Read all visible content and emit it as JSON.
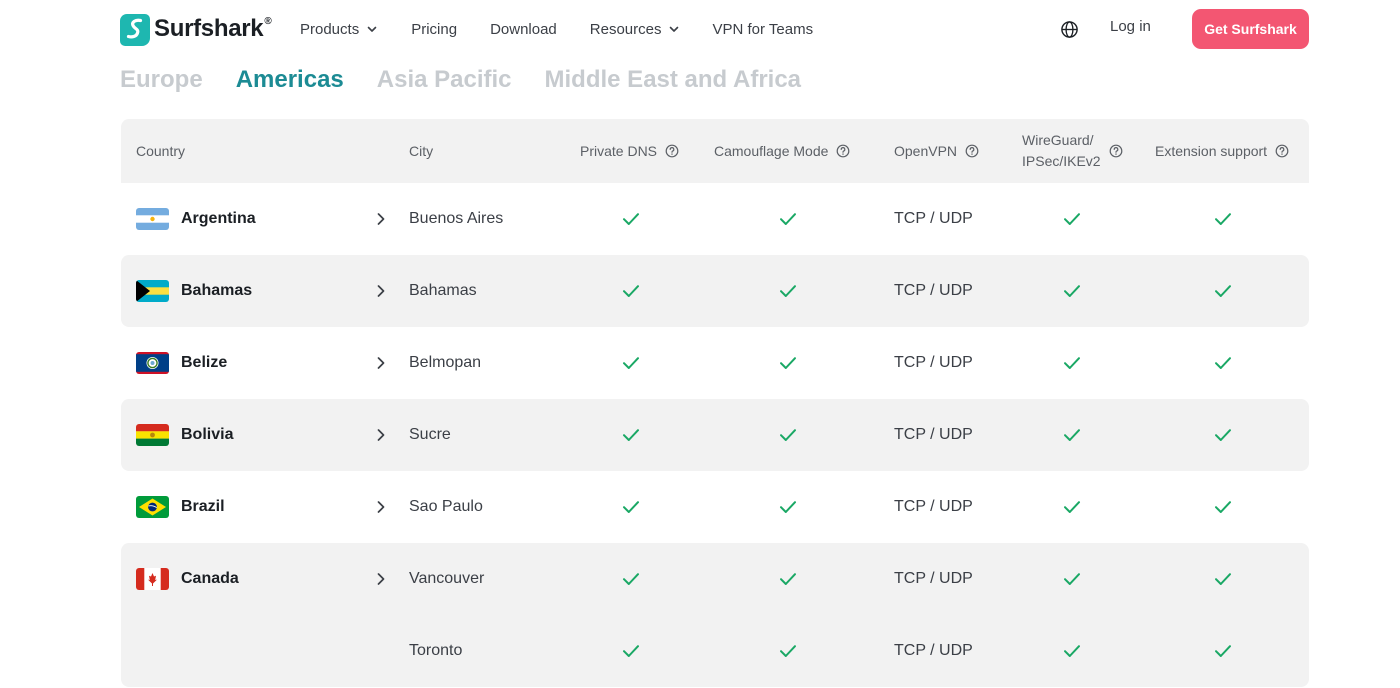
{
  "brand": {
    "name": "Surfshark",
    "reg_mark": "®",
    "accent_color": "#1c8b94",
    "logo_color": "#1eb7b0",
    "cta_color": "#f35672",
    "check_color": "#1aa865"
  },
  "nav": {
    "products": "Products",
    "pricing": "Pricing",
    "download": "Download",
    "resources": "Resources",
    "vpn_for_teams": "VPN for Teams",
    "language_icon": "globe-icon",
    "login": "Log in",
    "cta": "Get Surfshark"
  },
  "regions": {
    "tabs": [
      "Europe",
      "Americas",
      "Asia Pacific",
      "Middle East and Africa"
    ],
    "active": "Americas"
  },
  "table": {
    "headers": {
      "country": "Country",
      "city": "City",
      "private_dns": "Private DNS",
      "camouflage": "Camouflage Mode",
      "openvpn": "OpenVPN",
      "wireguard_line1": "WireGuard/",
      "wireguard_line2": "IPSec/IKEv2",
      "extension": "Extension support"
    },
    "rows": [
      {
        "country": "Argentina",
        "city": "Buenos Aires",
        "private_dns": true,
        "camouflage": true,
        "openvpn": "TCP / UDP",
        "wireguard": true,
        "extension": true,
        "flag_icon": "argentina-flag-icon"
      },
      {
        "country": "Bahamas",
        "city": "Bahamas",
        "private_dns": true,
        "camouflage": true,
        "openvpn": "TCP / UDP",
        "wireguard": true,
        "extension": true,
        "flag_icon": "bahamas-flag-icon"
      },
      {
        "country": "Belize",
        "city": "Belmopan",
        "private_dns": true,
        "camouflage": true,
        "openvpn": "TCP / UDP",
        "wireguard": true,
        "extension": true,
        "flag_icon": "belize-flag-icon"
      },
      {
        "country": "Bolivia",
        "city": "Sucre",
        "private_dns": true,
        "camouflage": true,
        "openvpn": "TCP / UDP",
        "wireguard": true,
        "extension": true,
        "flag_icon": "bolivia-flag-icon"
      },
      {
        "country": "Brazil",
        "city": "Sao Paulo",
        "private_dns": true,
        "camouflage": true,
        "openvpn": "TCP / UDP",
        "wireguard": true,
        "extension": true,
        "flag_icon": "brazil-flag-icon"
      },
      {
        "country": "Canada",
        "city": "Vancouver",
        "private_dns": true,
        "camouflage": true,
        "openvpn": "TCP / UDP",
        "wireguard": true,
        "extension": true,
        "flag_icon": "canada-flag-icon"
      },
      {
        "country": "",
        "city": "Toronto",
        "private_dns": true,
        "camouflage": true,
        "openvpn": "TCP / UDP",
        "wireguard": true,
        "extension": true
      }
    ]
  }
}
